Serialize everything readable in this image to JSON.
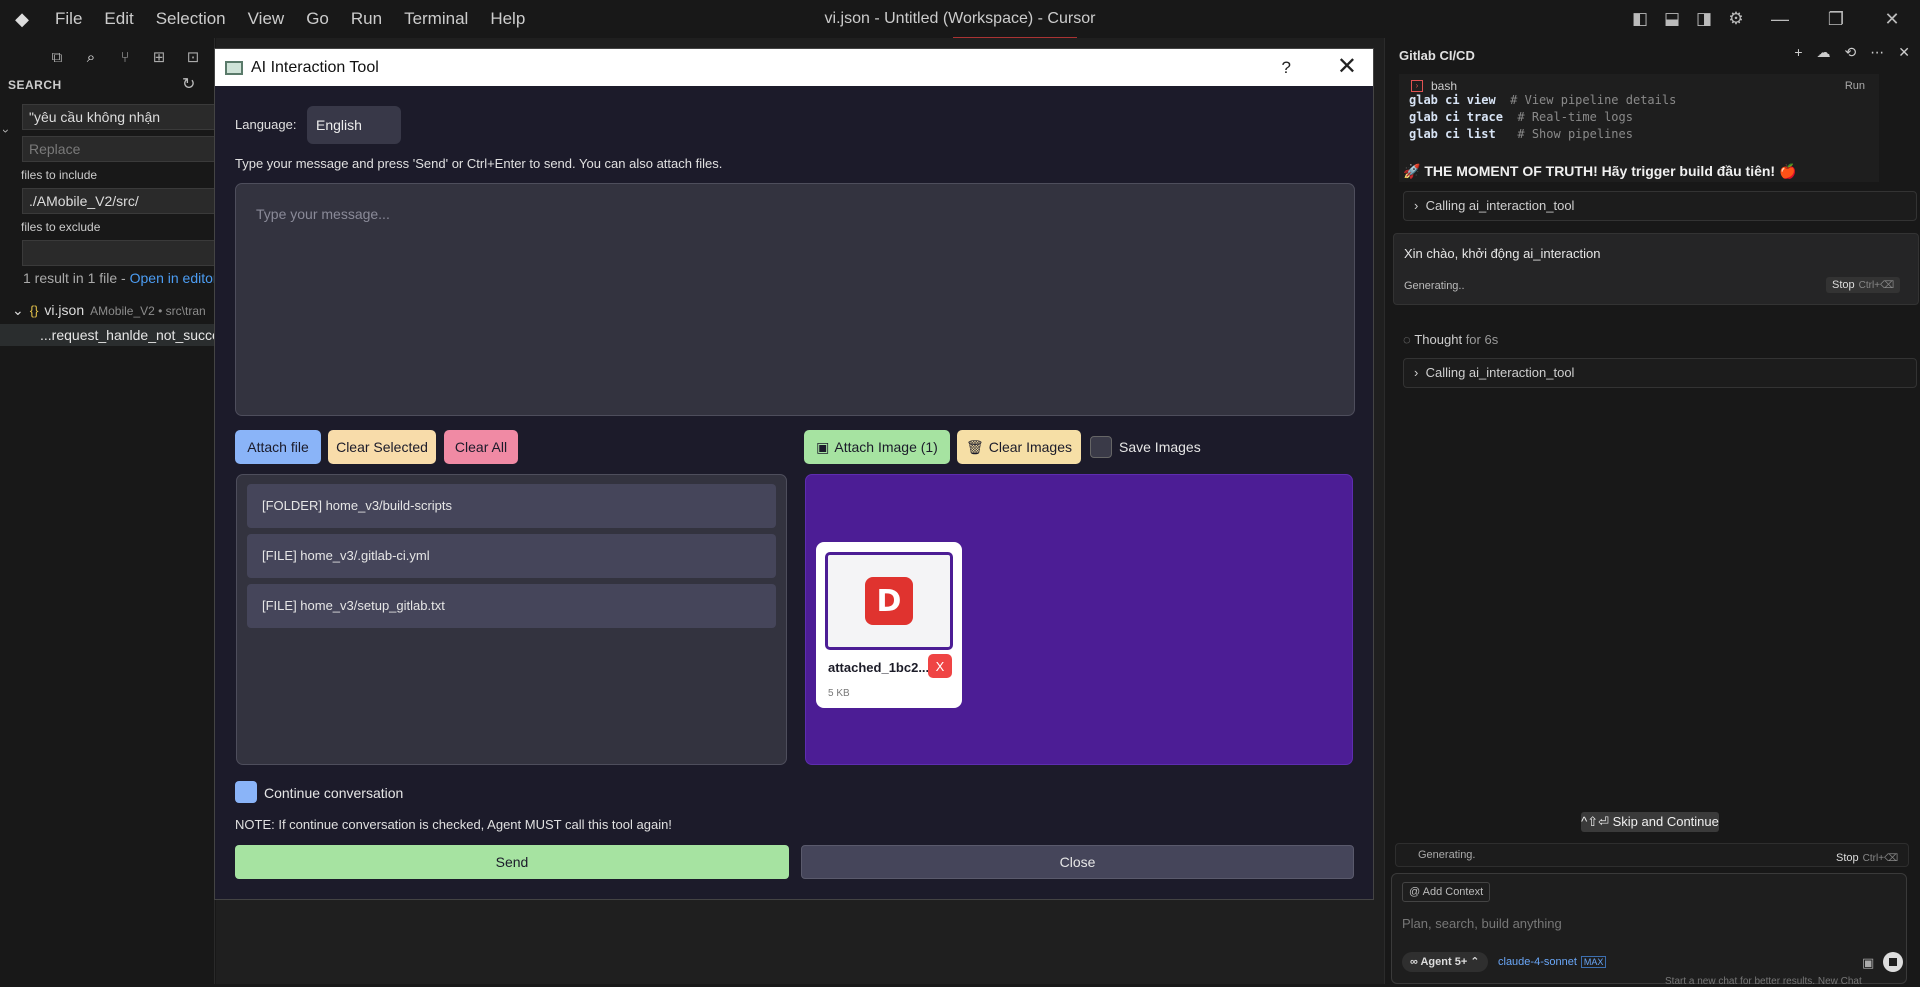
{
  "titlebar": {
    "menu": [
      "File",
      "Edit",
      "Selection",
      "View",
      "Go",
      "Run",
      "Terminal",
      "Help"
    ],
    "window_title": "vi.json - Untitled (Workspace) - Cursor"
  },
  "sidebar": {
    "header": "SEARCH",
    "search_value": "\"yêu cầu không nhận",
    "replace_placeholder": "Replace",
    "include_label": "files to include",
    "include_value": "./AMobile_V2/src/",
    "exclude_label": "files to exclude",
    "exclude_value": "",
    "result_summary": "1 result in 1 file - ",
    "open_in_editor": "Open in editor",
    "file_name": "vi.json",
    "file_path": "AMobile_V2 • src\\tran",
    "match_text": "...request_hanlde_not_success"
  },
  "dialog": {
    "title": "AI Interaction Tool",
    "help": "?",
    "language_label": "Language:",
    "language_value": "English",
    "hint": "Type your message and press 'Send' or Ctrl+Enter to send. You can also attach files.",
    "message_placeholder": "Type your message...",
    "attach_file": "Attach file",
    "clear_selected": "Clear Selected",
    "clear_all": "Clear All",
    "attach_image": "Attach Image (1)",
    "clear_images": "Clear Images",
    "save_images": "Save Images",
    "files": [
      "[FOLDER] home_v3/build-scripts",
      "[FILE] home_v3/.gitlab-ci.yml",
      "[FILE] home_v3/setup_gitlab.txt"
    ],
    "image": {
      "name": "attached_1bc2...",
      "size": "5 KB",
      "delete": "X",
      "logo_letter": "D"
    },
    "continue_label": "Continue conversation",
    "note": "NOTE: If continue conversation is checked, Agent MUST call this tool again!",
    "send": "Send",
    "close": "Close",
    "accent_purple": "#4c1d95"
  },
  "chat": {
    "title": "Gitlab CI/CD",
    "code_lang": "bash",
    "code_run": "Run",
    "code_lines": [
      {
        "cmd": "glab ci view ",
        "comment": " # View pipeline details"
      },
      {
        "cmd": "glab ci trace",
        "comment": "  # Real-time logs"
      },
      {
        "cmd": "glab ci list ",
        "comment": "  # Show pipelines"
      }
    ],
    "moment": "🚀 THE MOMENT OF TRUTH! Hãy trigger build đầu tiên! 🍎",
    "calling_1": "Calling ai_interaction_tool",
    "user_message": "Xin chào, khởi động ai_interaction",
    "generating": "Generating..",
    "stop": "Stop",
    "stop_kbd": "Ctrl+⌫",
    "thought": "Thought",
    "thought_time": "for 6s",
    "calling_2": "Calling ai_interaction_tool",
    "skip": "^⇧⏎ Skip and Continue",
    "generating_2": "Generating.",
    "add_context": "@ Add Context",
    "composer_placeholder": "Plan, search, build anything",
    "agent": "∞ Agent 5+ ⌃",
    "model": "claude-4-sonnet",
    "max": "MAX",
    "footer_hint": "Start a new chat for better results.   New Chat"
  }
}
